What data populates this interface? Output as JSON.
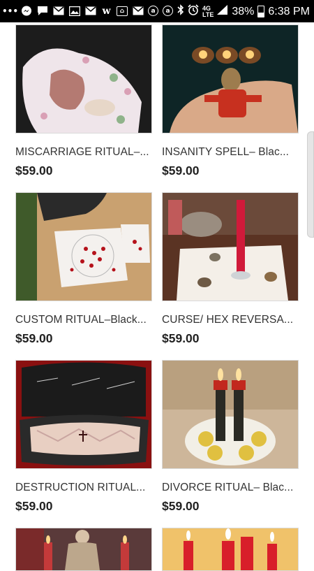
{
  "status_bar": {
    "notification_icons": [
      "ellipsis-icon",
      "messenger-icon",
      "message-icon",
      "mail-icon",
      "gallery-mail-icon",
      "mail-icon",
      "wish-icon",
      "shopping-bag-icon",
      "mail-icon",
      "lock-app-icon",
      "lock-app-icon"
    ],
    "battery_percent": "38%",
    "time": "6:38 PM",
    "network": "4G LTE",
    "battery_level": 0.38
  },
  "products": [
    {
      "title": "MISCARRIAGE RITUAL–...",
      "price": "$59.00",
      "image": "baby-doll-photo"
    },
    {
      "title": "INSANITY SPELL– Blac...",
      "price": "$59.00",
      "image": "voodoo-doll-photo"
    },
    {
      "title": "CUSTOM RITUAL–Black...",
      "price": "$59.00",
      "image": "ritual-petals-photo"
    },
    {
      "title": "CURSE/ HEX REVERSA...",
      "price": "$59.00",
      "image": "red-candle-altar-photo"
    },
    {
      "title": "DESTRUCTION RITUAL...",
      "price": "$59.00",
      "image": "coffin-photo"
    },
    {
      "title": "DIVORCE RITUAL– Blac...",
      "price": "$59.00",
      "image": "black-candles-lemons-photo"
    },
    {
      "title": "",
      "price": "",
      "image": "angel-statue-photo"
    },
    {
      "title": "",
      "price": "",
      "image": "red-candles-photo"
    }
  ]
}
